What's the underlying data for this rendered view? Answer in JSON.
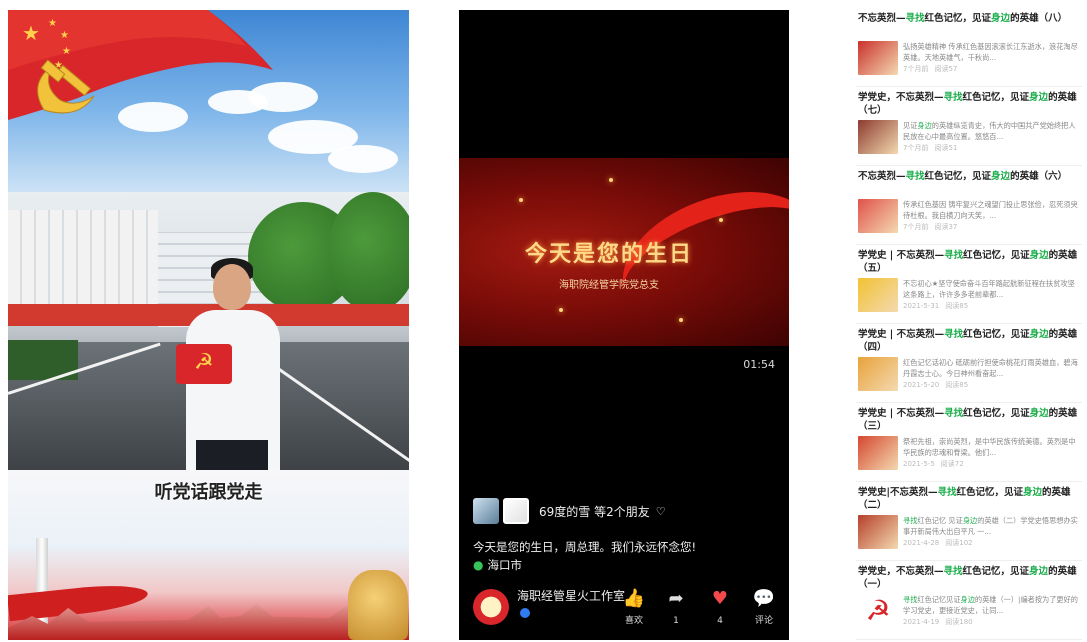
{
  "panel1": {
    "caption": "听党话跟党走",
    "icons": [
      "party-flag",
      "hammer-sickle",
      "mini-party-flag",
      "stone-lion",
      "huabiao-pillar"
    ]
  },
  "panel2": {
    "video": {
      "title": "今天是您的生日",
      "subtitle": "海职院经管学院党总支",
      "duration": "01:54"
    },
    "friends_text": "69度的雪 等2个朋友",
    "post_text": "今天是您的生日，周总理。我们永远怀念您!",
    "location": "海口市",
    "author": "海职经管星火工作室",
    "actions": [
      {
        "label": "喜欢",
        "icon": "thumb-up-icon",
        "glyph": "👍",
        "color": "#dddddd"
      },
      {
        "label": "1",
        "icon": "share-icon",
        "glyph": "➦",
        "color": "#dddddd"
      },
      {
        "label": "4",
        "icon": "heart-icon",
        "glyph": "♥",
        "color": "#f24a4a"
      },
      {
        "label": "评论",
        "icon": "comment-icon",
        "glyph": "💬",
        "color": "#dddddd"
      }
    ]
  },
  "articles": [
    {
      "title_html": "不忘英烈—<span class='hl'>寻找</span>红色记忆，见证<span class='hl'>身边</span>的英雄（八）",
      "summary_html": "弘扬英雄精神 传承红色基因滚滚长江东逝水，浪花淘尽英雄。天地英雄气，千秋尚...",
      "date": "7个月前",
      "reads": "阅读57",
      "thumb": "#c9302c"
    },
    {
      "title_html": "学党史，不忘英烈—<span class='hl'>寻找</span>红色记忆，见证<span class='hl'>身边</span>的英雄（七）",
      "summary_html": "见证<span class='hl'>身边</span>的英雄纵览青史，伟大的中国共产党始终把人民放在心中最高位置。悠悠百...",
      "date": "7个月前",
      "reads": "阅读51",
      "thumb": "#8b3a2f"
    },
    {
      "title_html": "不忘英烈—<span class='hl'>寻找</span>红色记忆，见证<span class='hl'>身边</span>的英雄（六）",
      "summary_html": "传承红色基因 铸牢复兴之魂望门投止思张俭，忍死须臾待杜根。我自横刀向天笑，...",
      "date": "7个月前",
      "reads": "阅读37",
      "thumb": "#e0524a"
    },
    {
      "title_html": "学党史 | 不忘英烈—<span class='hl'>寻找</span>红色记忆，见证<span class='hl'>身边</span>的英雄（五）",
      "summary_html": "不忘初心★坚守使命奋斗百年路起航新征程在扶贫攻坚这条路上，许许多多老前辈都...",
      "date": "2021-5-31",
      "reads": "阅读85",
      "thumb": "#f1c232"
    },
    {
      "title_html": "学党史 | 不忘英烈—<span class='hl'>寻找</span>红色记忆，见证<span class='hl'>身边</span>的英雄（四）",
      "summary_html": "红色记忆话初心 砥砺前行担使命桃花灯雨英雄血，碧海丹霞志士心。今日神州看奋起...",
      "date": "2021-5-20",
      "reads": "阅读85",
      "thumb": "#e8a23a"
    },
    {
      "title_html": "学党史 | 不忘英烈—<span class='hl'>寻找</span>红色记忆，见证<span class='hl'>身边</span>的英雄（三）",
      "summary_html": "祭祀先祖，崇尚英烈，是中华民族传统美德。英烈是中华民族的忠魂和脊梁。他们...",
      "date": "2021-5-5",
      "reads": "阅读72",
      "thumb": "#d4472f"
    },
    {
      "title_html": "学党史|不忘英烈—<span class='hl'>寻找</span>红色记忆，见证<span class='hl'>身边</span>的英雄（二）",
      "summary_html": "<span class='hl'>寻找</span>红色记忆 见证<span class='hl'>身边</span>的英雄（二）学党史悟思想办实事开新局伟大出自平凡 一...",
      "date": "2021-4-28",
      "reads": "阅读102",
      "thumb": "#b5402a"
    },
    {
      "title_html": "学党史，不忘英烈—<span class='hl'>寻找</span>红色记忆，见证<span class='hl'>身边</span>的英雄（一）",
      "summary_html": "<span class='hl'>寻找</span>红色记忆见证<span class='hl'>身边</span>的英雄（一）|编者按为了更好的学习党史，更接近党史，让同...",
      "date": "2021-4-19",
      "reads": "阅读180",
      "thumb": "#ffffff"
    }
  ]
}
